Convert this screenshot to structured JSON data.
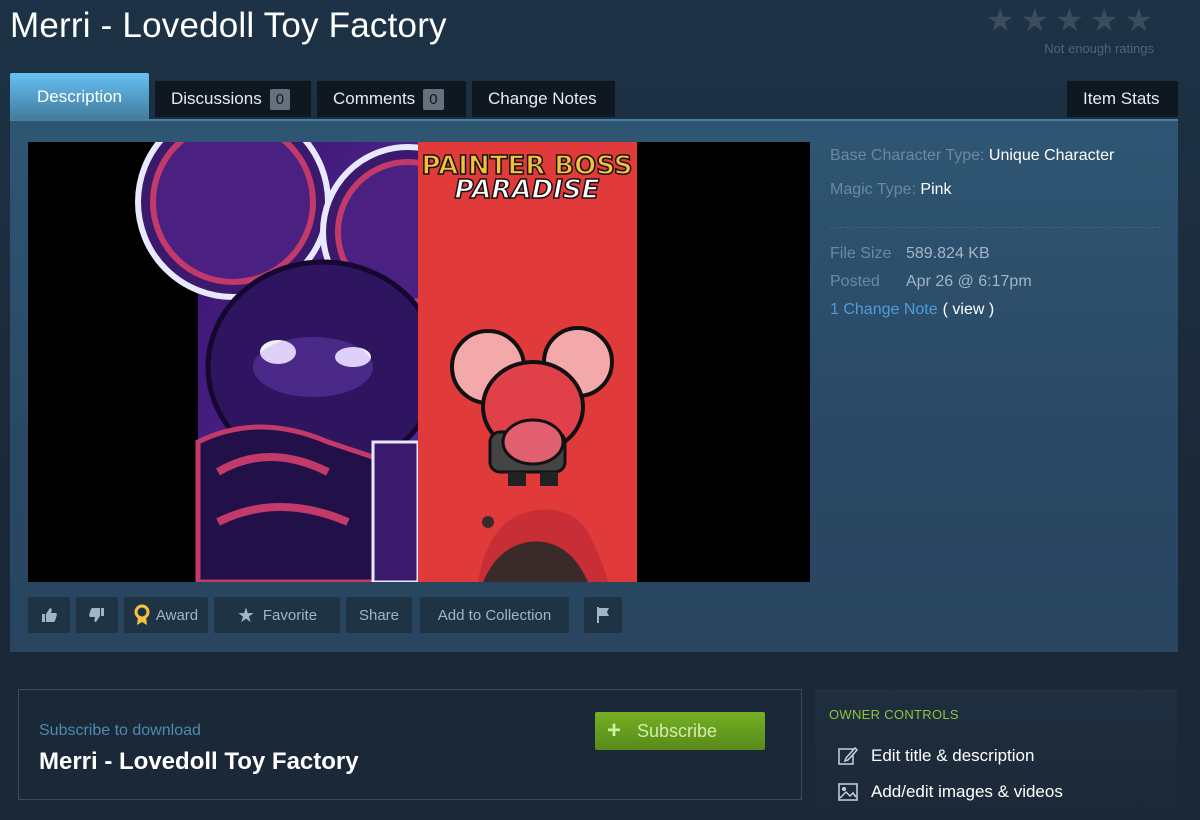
{
  "page": {
    "title": "Merri - Lovedoll Toy Factory"
  },
  "rating": {
    "stars_total": 5,
    "stars_filled": 0,
    "text": "Not enough ratings"
  },
  "tabs": [
    {
      "label": "Description",
      "active": true
    },
    {
      "label": "Discussions",
      "count": "0"
    },
    {
      "label": "Comments",
      "count": "0"
    },
    {
      "label": "Change Notes"
    },
    {
      "label": "Item Stats"
    }
  ],
  "media": {
    "banner_text_line1": "PAINTER BOSS",
    "banner_text_line2": "PARADISE"
  },
  "actions": {
    "thumbs_up_icon": "thumbs-up-icon",
    "thumbs_down_icon": "thumbs-down-icon",
    "award_label": "Award",
    "favorite_label": "Favorite",
    "share_label": "Share",
    "add_to_collection_label": "Add to Collection",
    "flag_icon": "flag-icon"
  },
  "details": {
    "base_character_label": "Base Character Type:",
    "base_character_value": "Unique Character",
    "magic_type_label": "Magic Type:",
    "magic_type_value": "Pink",
    "file_size_label": "File Size",
    "file_size_value": "589.824 KB",
    "posted_label": "Posted",
    "posted_value": "Apr 26 @ 6:17pm",
    "change_note_link": "1 Change Note",
    "view_text": "( view )"
  },
  "subscribe": {
    "label": "Subscribe to download",
    "title": "Merri - Lovedoll Toy Factory",
    "button_label": "Subscribe"
  },
  "owner_controls": {
    "heading": "OWNER CONTROLS",
    "items": [
      {
        "label": "Edit title & description",
        "icon": "edit-icon"
      },
      {
        "label": "Add/edit images & videos",
        "icon": "image-icon"
      }
    ]
  },
  "colors": {
    "accent_blue": "#67c1f5",
    "subscribe_green": "#75b022",
    "owner_green": "#8bc53f",
    "background": "#1b2838"
  }
}
